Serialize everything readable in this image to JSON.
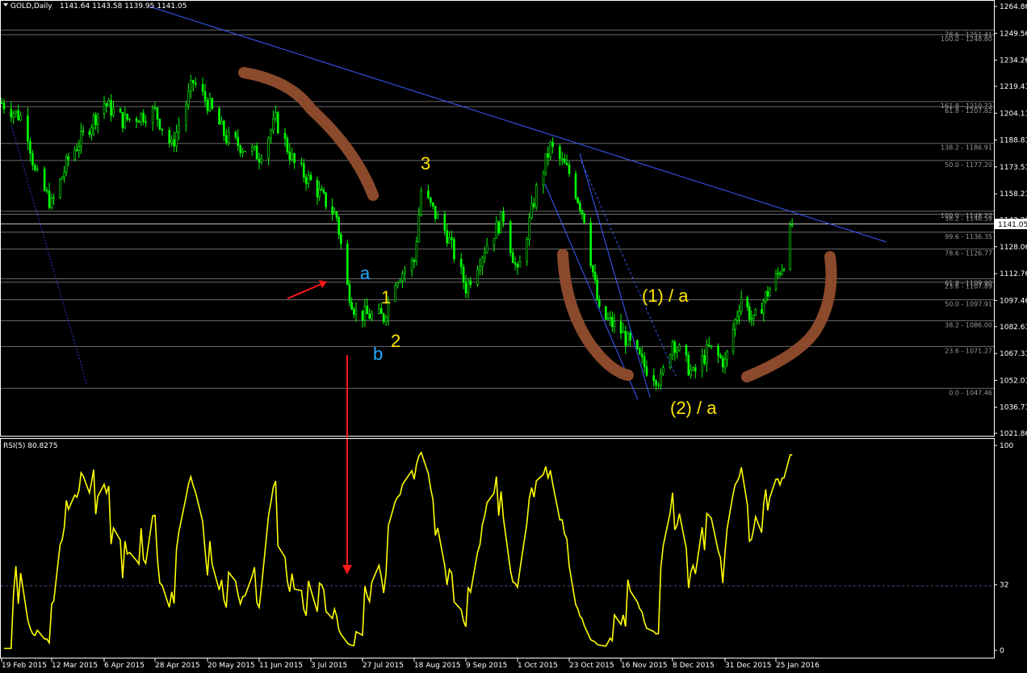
{
  "header": {
    "symbol_label": "GOLD,Daily",
    "ohlc": "1141.64 1143.58 1139.95 1141.05"
  },
  "rsi_header": "RSI(5) 80.8275",
  "colors": {
    "background": "#000000",
    "candle": "#00ff00",
    "trendline": "#3b5bff",
    "fib_line": "#6b6b6b",
    "rsi_line": "#ffff00",
    "annotation_yellow": "#ffe600",
    "annotation_blue": "#22aaff",
    "arc_brown": "#8b4a2b",
    "arrow_red": "#ff1a1a"
  },
  "chart_data": [
    {
      "type": "candlestick",
      "title": "GOLD,Daily",
      "ylim": [
        1021.86,
        1264.86
      ],
      "y_ticks": [
        "1264.86",
        "1249.56",
        "1234.26",
        "1219.41",
        "1204.11",
        "1188.81",
        "1173.51",
        "1158.21",
        "1143.36",
        "1128.06",
        "1112.76",
        "1097.46",
        "1082.61",
        "1067.31",
        "1052.01",
        "1036.71",
        "1021.86"
      ],
      "x_tick_labels": [
        "19 Feb 2015",
        "12 Mar 2015",
        "6 Apr 2015",
        "28 Apr 2015",
        "20 May 2015",
        "11 Jun 2015",
        "3 Jul 2015",
        "27 Jul 2015",
        "18 Aug 2015",
        "9 Sep 2015",
        "1 Oct 2015",
        "23 Oct 2015",
        "16 Nov 2015",
        "8 Dec 2015",
        "31 Dec 2015",
        "25 Jan 2016"
      ],
      "close_path_approx": [
        [
          "19 Feb 2015",
          1210
        ],
        [
          "1 Mar 2015",
          1200
        ],
        [
          "5 Mar 2015",
          1170
        ],
        [
          "12 Mar 2015",
          1152
        ],
        [
          "20 Mar 2015",
          1178
        ],
        [
          "6 Apr 2015",
          1210
        ],
        [
          "14 Apr 2015",
          1200
        ],
        [
          "28 Apr 2015",
          1205
        ],
        [
          "5 May 2015",
          1185
        ],
        [
          "14 May 2015",
          1222
        ],
        [
          "20 May 2015",
          1210
        ],
        [
          "28 May 2015",
          1190
        ],
        [
          "11 Jun 2015",
          1180
        ],
        [
          "18 Jun 2015",
          1200
        ],
        [
          "26 Jun 2015",
          1175
        ],
        [
          "3 Jul 2015",
          1165
        ],
        [
          "15 Jul 2015",
          1145
        ],
        [
          "20 Jul 2015",
          1105
        ],
        [
          "24 Jul 2015",
          1090
        ],
        [
          "5 Aug 2015",
          1088
        ],
        [
          "10 Aug 2015",
          1110
        ],
        [
          "18 Aug 2015",
          1120
        ],
        [
          "21 Aug 2015",
          1160
        ],
        [
          "1 Sep 2015",
          1135
        ],
        [
          "9 Sep 2015",
          1105
        ],
        [
          "18 Sep 2015",
          1130
        ],
        [
          "25 Sep 2015",
          1145
        ],
        [
          "1 Oct 2015",
          1112
        ],
        [
          "9 Oct 2015",
          1160
        ],
        [
          "15 Oct 2015",
          1185
        ],
        [
          "23 Oct 2015",
          1170
        ],
        [
          "30 Oct 2015",
          1145
        ],
        [
          "6 Nov 2015",
          1090
        ],
        [
          "16 Nov 2015",
          1080
        ],
        [
          "26 Nov 2015",
          1060
        ],
        [
          "3 Dec 2015",
          1052
        ],
        [
          "8 Dec 2015",
          1075
        ],
        [
          "17 Dec 2015",
          1055
        ],
        [
          "24 Dec 2015",
          1070
        ],
        [
          "31 Dec 2015",
          1062
        ],
        [
          "8 Jan 2016",
          1100
        ],
        [
          "14 Jan 2016",
          1085
        ],
        [
          "20 Jan 2016",
          1100
        ],
        [
          "25 Jan 2016",
          1110
        ],
        [
          "29 Jan 2016",
          1120
        ],
        [
          "2 Feb 2016",
          1141
        ]
      ],
      "fib_levels": [
        {
          "label": "78.6 - 1251.41"
        },
        {
          "label": "100.0 - 1248.80"
        },
        {
          "label": "161.8 - 1210.73"
        },
        {
          "label": "61.8 - 1207.82"
        },
        {
          "label": "138.2 - 1186.91"
        },
        {
          "label": "50.0 - 1177.20"
        },
        {
          "label": "100.0 - 1148.27"
        },
        {
          "label": "38.2 - 1146.59"
        },
        {
          "label": "99.6 - 1136.35"
        },
        {
          "label": "78.6 - 1126.77"
        },
        {
          "label": "61.8 - 1109.90"
        },
        {
          "label": "23.6 - 1107.89"
        },
        {
          "label": "50.0 - 1097.91"
        },
        {
          "label": "38.2 - 1086.00"
        },
        {
          "label": "23.6 - 1071.27"
        },
        {
          "label": "0.0 - 1047.46"
        }
      ],
      "last_price_label": "1141.05",
      "annotations": [
        "a",
        "b",
        "1",
        "2",
        "3",
        "(1) / a",
        "(2) / a"
      ]
    },
    {
      "type": "line",
      "title": "RSI(5) 80.8275",
      "ylim": [
        0,
        100
      ],
      "y_ticks": [
        "100",
        "32",
        "0"
      ],
      "reference_level": 32
    }
  ]
}
